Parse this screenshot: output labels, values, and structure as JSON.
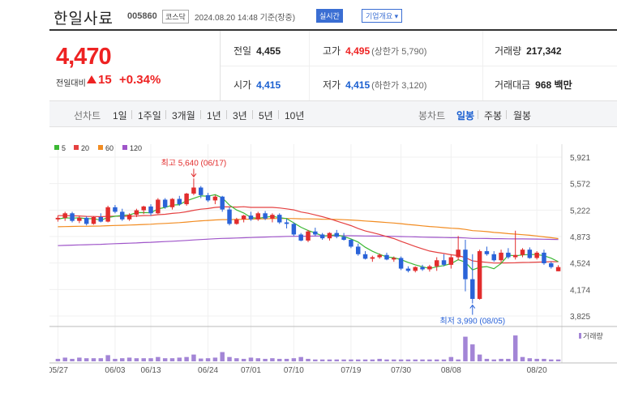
{
  "header": {
    "name": "한일사료",
    "code": "005860",
    "market": "코스닥",
    "datetime": "2024.08.20 14:48 기준(장중)",
    "realtime": "실시간",
    "company_info": "기업개요 ▾"
  },
  "price": {
    "current": "4,470",
    "change_label": "전일대비",
    "change": "15",
    "change_pct": "+0.34%"
  },
  "stats": {
    "prev_label": "전일",
    "prev": "4,455",
    "high_label": "고가",
    "high": "4,495",
    "high_sub": "(상한가 5,790)",
    "vol_label": "거래량",
    "volume": "217,342",
    "open_label": "시가",
    "open": "4,415",
    "low_label": "저가",
    "low": "4,415",
    "low_sub": "(하한가 3,120)",
    "amt_label": "거래대금",
    "amount": "968 백만"
  },
  "nav": {
    "line_label": "선차트",
    "line_opts": [
      "1일",
      "1주일",
      "3개월",
      "1년",
      "3년",
      "5년",
      "10년"
    ],
    "candle_label": "봉차트",
    "candle_opts": [
      "일봉",
      "주봉",
      "월봉"
    ],
    "selected": "일봉"
  },
  "colors": {
    "up": "#e22d2d",
    "down": "#2a63d8",
    "ma5": "#3cb834",
    "ma20": "#e54141",
    "ma60": "#f28c21",
    "ma120": "#9f55c9",
    "volume": "#a385d6"
  },
  "chart_data": {
    "type": "candlestick",
    "legend": [
      "5",
      "20",
      "60",
      "120"
    ],
    "yticks": [
      "5,921",
      "5,572",
      "5,222",
      "4,873",
      "4,524",
      "4,174",
      "3,825"
    ],
    "ylim": [
      3825,
      5921
    ],
    "xticks": [
      "05/27",
      "06/03",
      "06/13",
      "06/24",
      "07/01",
      "07/10",
      "07/19",
      "07/30",
      "08/08",
      "08/20"
    ],
    "high_annot": "최고 5,640 (06/17)",
    "low_annot": "최저 3,990 (08/05)",
    "volume_label": "거래량",
    "candles": [
      [
        5100,
        5150,
        5070,
        5120
      ],
      [
        5120,
        5200,
        5080,
        5180
      ],
      [
        5180,
        5200,
        5060,
        5080
      ],
      [
        5080,
        5150,
        5050,
        5120
      ],
      [
        5120,
        5140,
        5020,
        5040
      ],
      [
        5040,
        5140,
        5030,
        5130
      ],
      [
        5130,
        5180,
        5060,
        5070
      ],
      [
        5070,
        5280,
        5060,
        5260
      ],
      [
        5260,
        5290,
        5180,
        5200
      ],
      [
        5200,
        5240,
        5080,
        5100
      ],
      [
        5100,
        5180,
        5080,
        5160
      ],
      [
        5160,
        5240,
        5130,
        5220
      ],
      [
        5220,
        5280,
        5170,
        5270
      ],
      [
        5270,
        5300,
        5150,
        5180
      ],
      [
        5180,
        5380,
        5170,
        5360
      ],
      [
        5360,
        5380,
        5240,
        5260
      ],
      [
        5260,
        5380,
        5230,
        5370
      ],
      [
        5370,
        5410,
        5280,
        5300
      ],
      [
        5300,
        5450,
        5280,
        5440
      ],
      [
        5440,
        5640,
        5420,
        5520
      ],
      [
        5520,
        5540,
        5380,
        5420
      ],
      [
        5420,
        5450,
        5330,
        5350
      ],
      [
        5350,
        5420,
        5300,
        5400
      ],
      [
        5400,
        5410,
        5200,
        5230
      ],
      [
        5230,
        5260,
        5020,
        5040
      ],
      [
        5040,
        5120,
        5030,
        5100
      ],
      [
        5100,
        5160,
        5060,
        5150
      ],
      [
        5150,
        5200,
        5080,
        5100
      ],
      [
        5100,
        5200,
        5080,
        5180
      ],
      [
        5180,
        5210,
        5090,
        5110
      ],
      [
        5110,
        5180,
        5060,
        5160
      ],
      [
        5160,
        5180,
        5040,
        5060
      ],
      [
        5060,
        5110,
        4980,
        5040
      ],
      [
        5040,
        5060,
        4880,
        4900
      ],
      [
        4900,
        4920,
        4810,
        4820
      ],
      [
        4820,
        4960,
        4800,
        4940
      ],
      [
        4940,
        4990,
        4880,
        4900
      ],
      [
        4900,
        4920,
        4830,
        4850
      ],
      [
        4850,
        4930,
        4820,
        4920
      ],
      [
        4920,
        4960,
        4850,
        4870
      ],
      [
        4870,
        4920,
        4820,
        4830
      ],
      [
        4830,
        4840,
        4720,
        4740
      ],
      [
        4740,
        4780,
        4620,
        4640
      ],
      [
        4640,
        4680,
        4570,
        4580
      ],
      [
        4580,
        4620,
        4540,
        4600
      ],
      [
        4600,
        4650,
        4580,
        4630
      ],
      [
        4630,
        4660,
        4560,
        4570
      ],
      [
        4570,
        4610,
        4540,
        4590
      ],
      [
        4590,
        4610,
        4430,
        4450
      ],
      [
        4450,
        4480,
        4400,
        4420
      ],
      [
        4420,
        4480,
        4400,
        4470
      ],
      [
        4470,
        4500,
        4420,
        4440
      ],
      [
        4440,
        4500,
        4410,
        4480
      ],
      [
        4480,
        4600,
        4420,
        4560
      ],
      [
        4560,
        4640,
        4480,
        4500
      ],
      [
        4500,
        4640,
        4450,
        4600
      ],
      [
        4600,
        4880,
        4560,
        4700
      ],
      [
        4700,
        4830,
        4150,
        4310
      ],
      [
        4310,
        4640,
        3990,
        4050
      ],
      [
        4050,
        4700,
        4040,
        4680
      ],
      [
        4680,
        4740,
        4620,
        4640
      ],
      [
        4640,
        4680,
        4540,
        4560
      ],
      [
        4560,
        4700,
        4530,
        4660
      ],
      [
        4660,
        4720,
        4580,
        4600
      ],
      [
        4600,
        4950,
        4570,
        4630
      ],
      [
        4630,
        4720,
        4600,
        4700
      ],
      [
        4700,
        4730,
        4580,
        4590
      ],
      [
        4590,
        4680,
        4570,
        4660
      ],
      [
        4660,
        4700,
        4500,
        4520
      ],
      [
        4520,
        4540,
        4450,
        4470
      ],
      [
        4415,
        4495,
        4415,
        4470
      ]
    ],
    "volumes": [
      0.08,
      0.12,
      0.08,
      0.12,
      0.1,
      0.1,
      0.1,
      0.2,
      0.08,
      0.1,
      0.12,
      0.1,
      0.1,
      0.1,
      0.14,
      0.1,
      0.1,
      0.12,
      0.14,
      0.22,
      0.09,
      0.1,
      0.12,
      0.3,
      0.14,
      0.1,
      0.08,
      0.12,
      0.1,
      0.08,
      0.1,
      0.08,
      0.08,
      0.1,
      0.14,
      0.08,
      0.06,
      0.06,
      0.06,
      0.06,
      0.06,
      0.06,
      0.06,
      0.06,
      0.06,
      0.08,
      0.06,
      0.06,
      0.06,
      0.06,
      0.06,
      0.06,
      0.06,
      0.06,
      0.06,
      0.14,
      0.06,
      0.8,
      0.55,
      0.22,
      0.08,
      0.06,
      0.08,
      0.08,
      0.84,
      0.14,
      0.1,
      0.08,
      0.08,
      0.06,
      0.06
    ]
  }
}
